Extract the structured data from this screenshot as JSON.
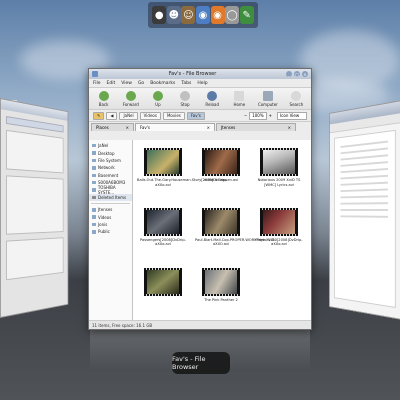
{
  "dock": {
    "icons": [
      "bug-icon",
      "people-icon",
      "cat-icon",
      "globe-icon",
      "firefox-icon",
      "clock-icon",
      "editor-icon"
    ]
  },
  "window": {
    "title": "Fav's - File Browser",
    "menu": [
      "File",
      "Edit",
      "View",
      "Go",
      "Bookmarks",
      "Tabs",
      "Help"
    ],
    "toolbar": [
      {
        "label": "Back",
        "color": "#6aa84f"
      },
      {
        "label": "Forward",
        "color": "#6aa84f"
      },
      {
        "label": "Up",
        "color": "#6aa84f"
      },
      {
        "label": "Stop",
        "color": "#c0c0c0"
      },
      {
        "label": "Reload",
        "color": "#5b7aa8"
      },
      {
        "label": "Home",
        "color": "#d8d8d8"
      },
      {
        "label": "Computer",
        "color": "#9aa8b8"
      },
      {
        "label": "Search",
        "color": "#d8d8d8"
      }
    ],
    "path": [
      "JaNel",
      "Videos",
      "Movies",
      "Fav's"
    ],
    "zoom": "100%",
    "view_mode": "Icon View",
    "tabs": [
      {
        "label": "Fav's",
        "active": true
      },
      {
        "label": "Jtenses",
        "active": false
      }
    ],
    "sidebar_header": "Places",
    "places": [
      "JaNel",
      "Desktop",
      "File System",
      "Network",
      "Basement",
      "S000A6BOM3",
      "TOSHIBA SYSTE...",
      "Deleted Items"
    ],
    "bookmarks": [
      "Jtenses",
      "Videos",
      "Jonis",
      "Public"
    ],
    "files": [
      "Balls.Out.The.Gary.Houseman.Story[2009]DvDrip-aXXo.avi",
      "make it happen.avi",
      "Notorious 2009 XviD TS [WMC] Lyrics.avi",
      "Passengers[2008]DvDrip-aXXo.avi",
      "Paul.Blart.Mall.Cop.PROPER.WORKPrint.XviD-aXXO.avi",
      "Player 5150[2008]DvDrip-aXXo.avi",
      "",
      "The Pink Panther 2"
    ],
    "status": "11 items, Free space: 16.1 GB"
  },
  "caption": "Fav's - File Browser"
}
